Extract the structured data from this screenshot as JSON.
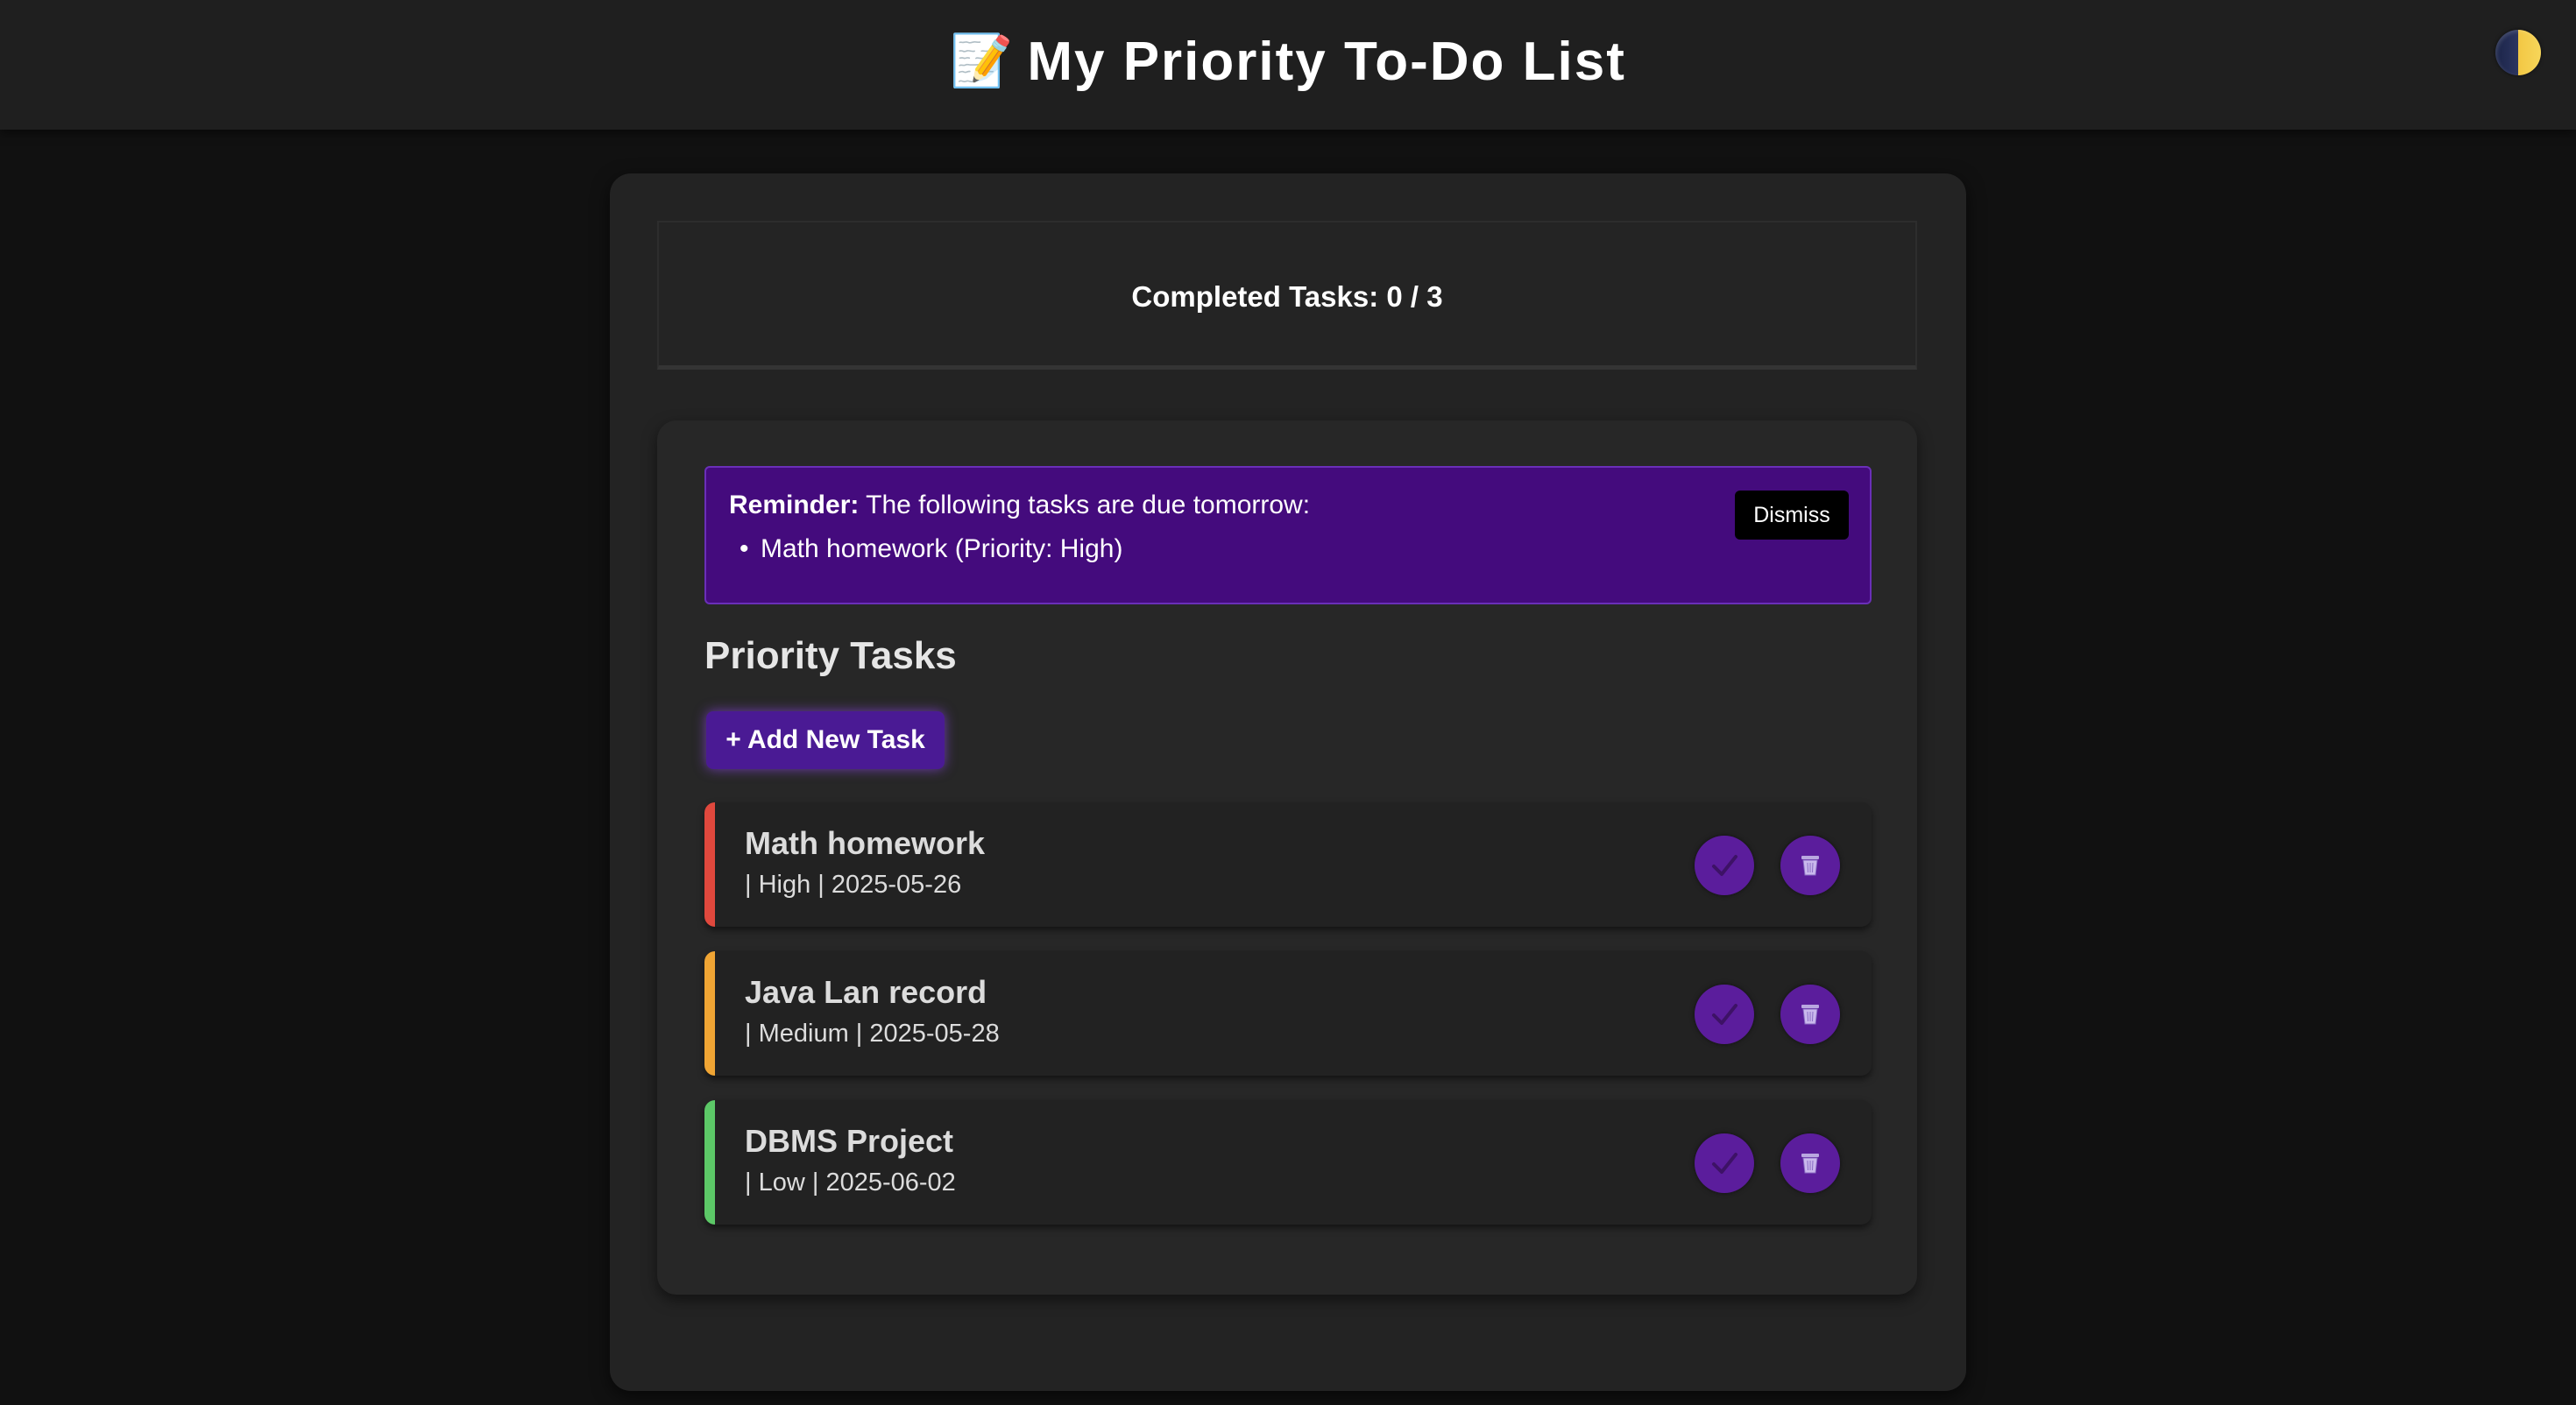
{
  "header": {
    "emoji": "📝",
    "title": "My Priority To-Do List",
    "theme_toggle_icon": "half-moon-icon"
  },
  "stats": {
    "completed_text": "Completed Tasks: 0 / 3"
  },
  "reminder": {
    "label": "Reminder:",
    "message": " The following tasks are due tomorrow:",
    "items": [
      "Math homework (Priority: High)"
    ],
    "dismiss_label": "Dismiss"
  },
  "tasks_section": {
    "title": "Priority Tasks",
    "add_button_label": "+ Add New Task"
  },
  "tasks": [
    {
      "name": "Math homework",
      "meta": "| High | 2025-05-26",
      "priority": "High",
      "due": "2025-05-26",
      "color": "#e0483d"
    },
    {
      "name": "Java Lan record",
      "meta": "| Medium | 2025-05-28",
      "priority": "Medium",
      "due": "2025-05-28",
      "color": "#f0a534"
    },
    {
      "name": "DBMS Project",
      "meta": "| Low | 2025-06-02",
      "priority": "Low",
      "due": "2025-06-02",
      "color": "#5cc867"
    }
  ],
  "icons": {
    "complete": "checkmark-icon",
    "delete": "trash-icon"
  },
  "colors": {
    "accent": "#5b1d9c",
    "reminder_bg": "#440b7d",
    "background": "#111111"
  }
}
